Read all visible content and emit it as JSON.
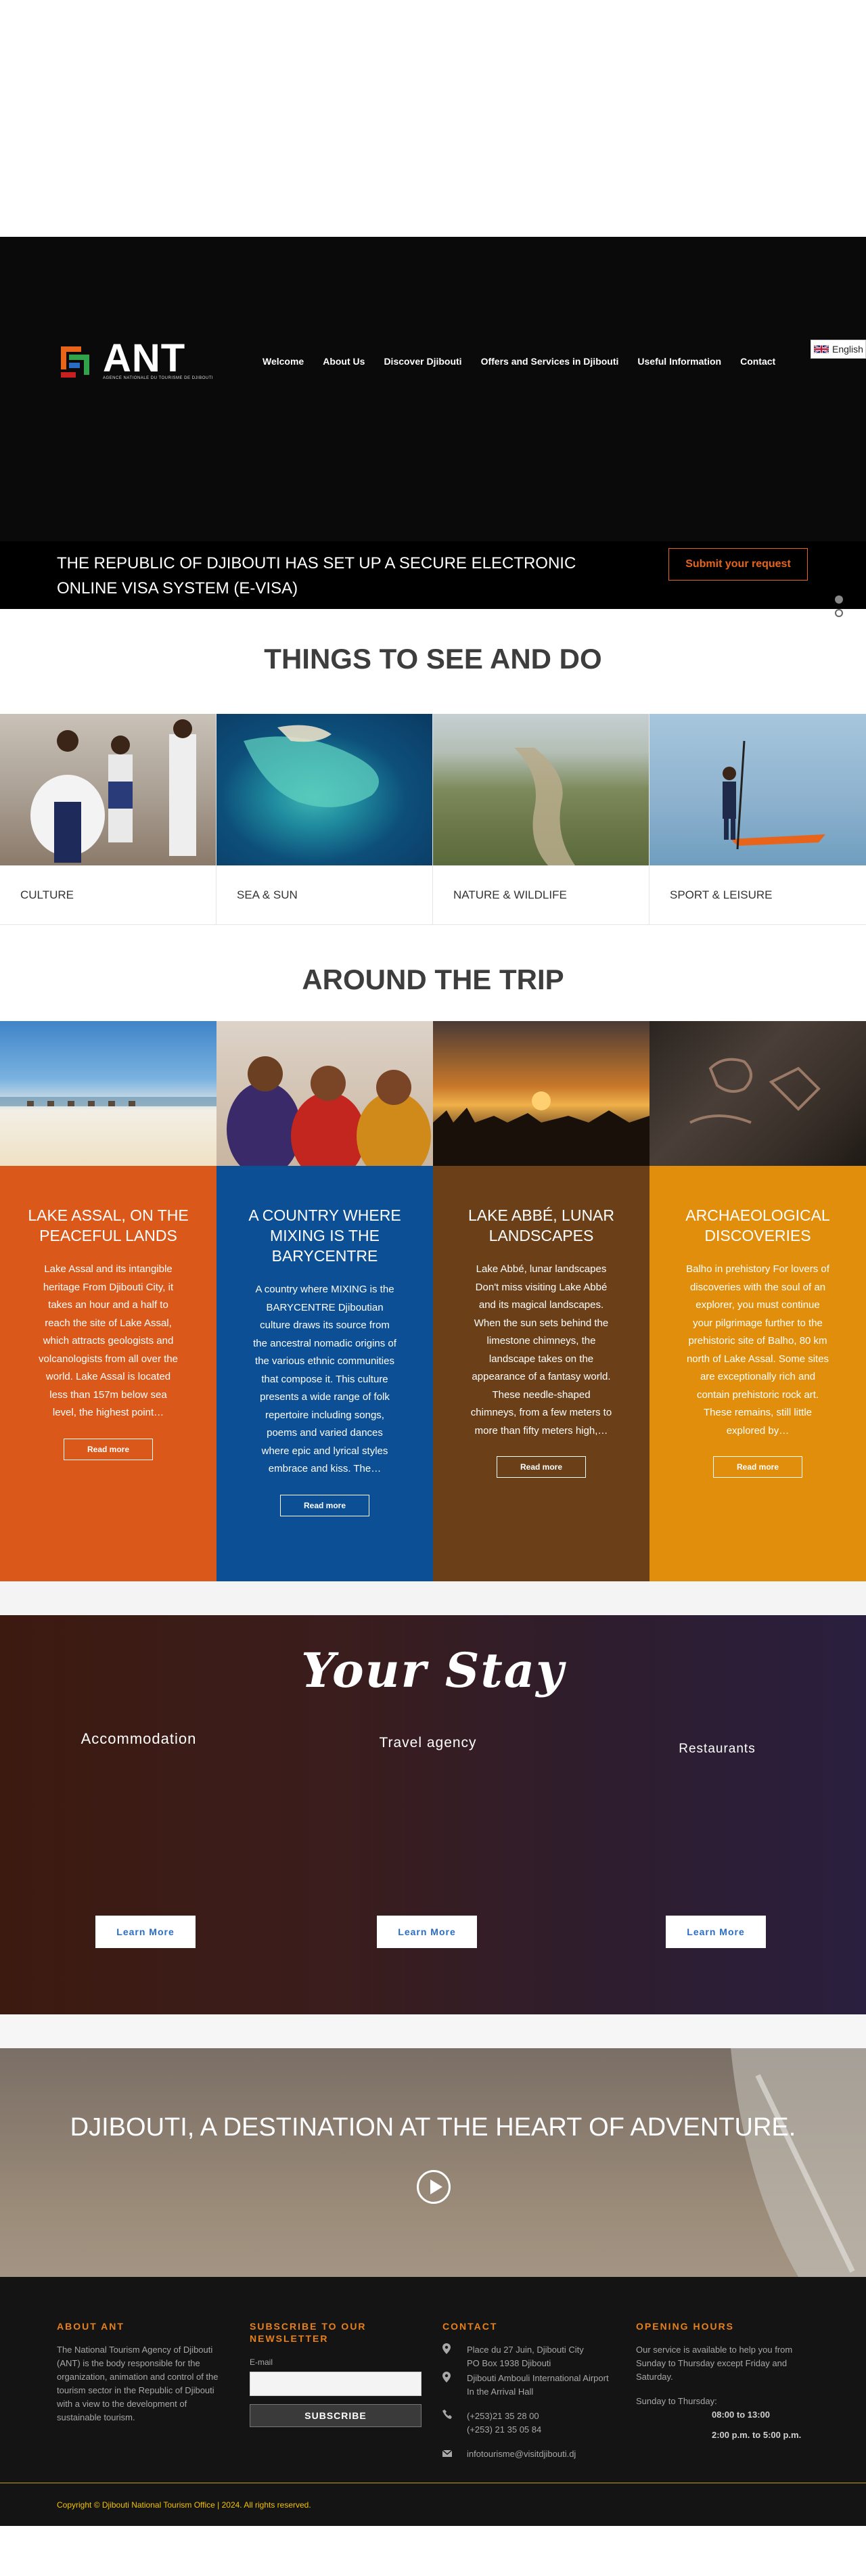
{
  "header": {
    "logo_text": "ANT",
    "logo_subtitle": "AGENCE NATIONALE DU TOURISME DE DJIBOUTI",
    "nav": [
      "Welcome",
      "About Us",
      "Discover Djibouti",
      "Offers and Services in Djibouti",
      "Useful Information",
      "Contact"
    ],
    "language": "English"
  },
  "visa": {
    "text": "THE REPUBLIC OF DJIBOUTI HAS SET UP A SECURE ELECTRONIC ONLINE VISA SYSTEM (E-VISA)",
    "button": "Submit your request"
  },
  "see_do": {
    "title": "THINGS TO SEE AND DO",
    "categories": [
      "CULTURE",
      "SEA & SUN",
      "NATURE & WILDLIFE",
      "SPORT & LEISURE"
    ]
  },
  "trip": {
    "title": "AROUND THE TRIP",
    "cards": [
      {
        "title": "LAKE ASSAL, ON THE PEACEFUL LANDS",
        "text": "Lake Assal and its intangible heritage From Djibouti City, it takes an hour and a half to reach the site of Lake Assal, which attracts geologists and volcanologists from all over the world. Lake Assal is located less than 157m below sea level, the highest point…",
        "button": "Read more",
        "color": "#d9581a"
      },
      {
        "title": "A COUNTRY WHERE MIXING IS THE BARYCENTRE",
        "text": "A country where MIXING is the BARYCENTRE Djiboutian culture draws its source from the ancestral nomadic origins of the various ethnic communities that compose it. This culture presents a wide range of folk repertoire including songs, poems and varied dances where epic and lyrical styles embrace and kiss. The…",
        "button": "Read more",
        "color": "#0c4f94"
      },
      {
        "title": "LAKE ABBÉ, LUNAR LANDSCAPES",
        "text": "Lake Abbé, lunar landscapes Don't miss visiting Lake Abbé and its magical landscapes. When the sun sets behind the limestone chimneys, the landscape takes on the appearance of a fantasy world. These needle-shaped chimneys, from a few meters to more than fifty meters high,…",
        "button": "Read more",
        "color": "#6b3f18"
      },
      {
        "title": "ARCHAEOLOGICAL DISCOVERIES",
        "text": "Balho in prehistory For lovers of discoveries with the soul of an explorer, you must continue your pilgrimage further to the prehistoric site of Balho, 80 km north of Lake Assal. Some sites are exceptionally rich and contain prehistoric rock art. These remains, still little explored by…",
        "button": "Read more",
        "color": "#e08e0b"
      }
    ]
  },
  "stay": {
    "title": "Your Stay",
    "columns": [
      {
        "label": "Accommodation",
        "button": "Learn More"
      },
      {
        "label": "Travel agency",
        "button": "Learn More"
      },
      {
        "label": "Restaurants",
        "button": "Learn More"
      }
    ]
  },
  "destination": {
    "title": "DJIBOUTI, A DESTINATION AT THE HEART OF ADVENTURE."
  },
  "footer": {
    "about": {
      "heading": "ABOUT ANT",
      "text": "The National Tourism Agency of Djibouti (ANT) is the body responsible for the organization, animation and control of the tourism sector in the Republic of Djibouti with a view to the development of sustainable tourism."
    },
    "newsletter": {
      "heading": "SUBSCRIBE TO OUR NEWSLETTER",
      "label": "E-mail",
      "button": "SUBSCRIBE"
    },
    "contact": {
      "heading": "CONTACT",
      "address1": "Place du 27 Juin, Djibouti City",
      "address2": "PO Box 1938 Djibouti",
      "address3": "Djibouti Ambouli International Airport",
      "address4": "In the Arrival Hall",
      "phone1": "(+253)21 35 28 00",
      "phone2": "(+253) 21 35 05 84",
      "email": "infotourisme@visitdjibouti.dj"
    },
    "hours": {
      "heading": "OPENING HOURS",
      "text": "Our service is available to help you from Sunday to Thursday except Friday and Saturday.",
      "label": "Sunday to Thursday:",
      "slot1": "08:00 to 13:00",
      "slot2": "2:00 p.m. to 5:00 p.m."
    },
    "copyright": "Copyright © Djibouti National Tourism Office | 2024. All rights reserved."
  }
}
